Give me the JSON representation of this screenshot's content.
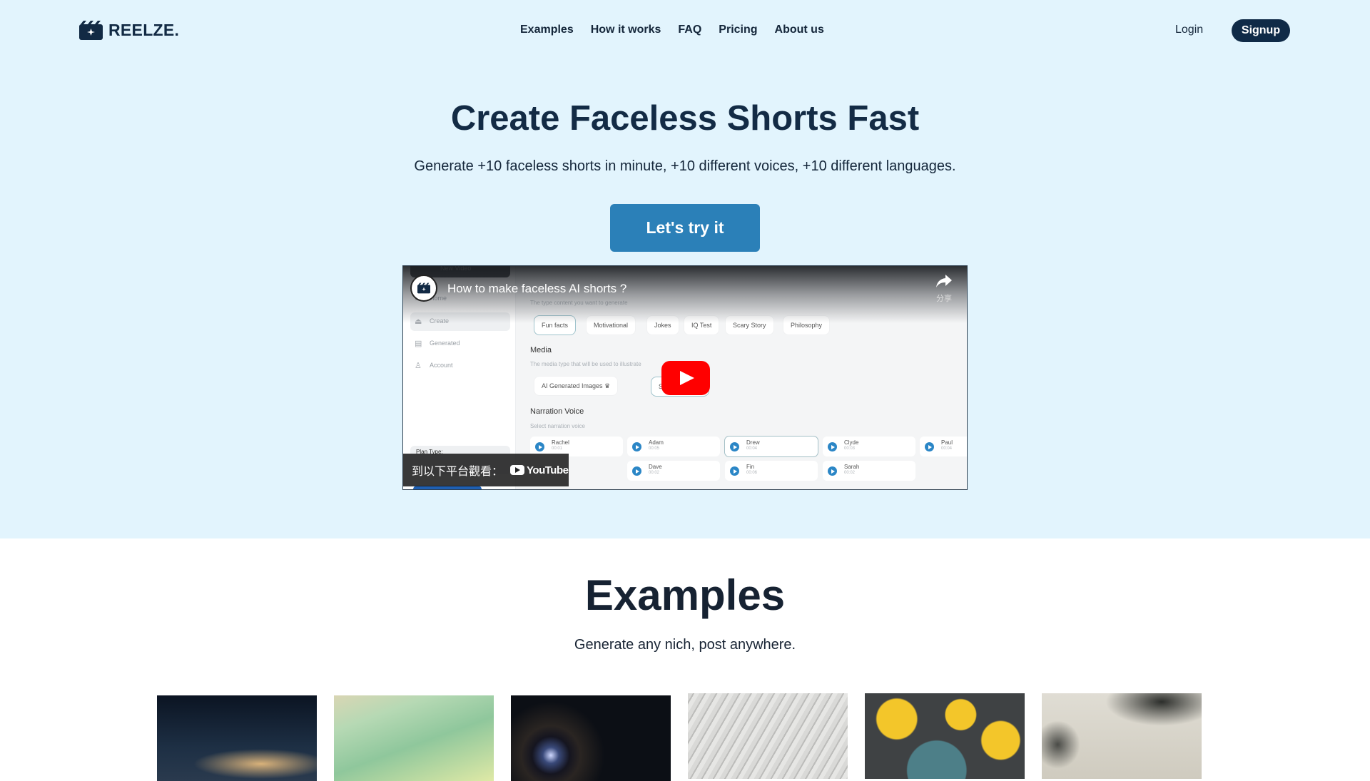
{
  "nav": {
    "brand": "REELZE.",
    "links": [
      "Examples",
      "How it works",
      "FAQ",
      "Pricing",
      "About us"
    ],
    "login": "Login",
    "signup": "Signup"
  },
  "hero": {
    "title": "Create Faceless Shorts Fast",
    "subtitle": "Generate +10 faceless shorts in minute, +10 different voices, +10 different languages.",
    "cta": "Let's try it"
  },
  "video": {
    "title": "How to make faceless AI shorts ?",
    "share_label": "分享",
    "watch_on": "到以下平台觀看：",
    "youtube_label": "YouTube",
    "app": {
      "new_video": "New Video",
      "sidebar": [
        {
          "icon": "home-icon",
          "label": "Home"
        },
        {
          "icon": "create-icon",
          "label": "Create"
        },
        {
          "icon": "generated-icon",
          "label": "Generated"
        },
        {
          "icon": "account-icon",
          "label": "Account"
        }
      ],
      "plan_type": "Plan Type:",
      "type_hint": "The type content you want to generate",
      "topics": [
        "Fun facts",
        "Motivational",
        "Jokes",
        "IQ Test",
        "Scary Story",
        "Philosophy"
      ],
      "media_label": "Media",
      "media_hint": "The media type that will be used to illustrate",
      "media_options": [
        "AI Generated Images ♛",
        "Stock Videos"
      ],
      "narration_label": "Narration Voice",
      "narration_hint": "Select narration voice",
      "voices": [
        {
          "name": "Rachel",
          "duration": "00:01"
        },
        {
          "name": "Adam",
          "duration": "00:05"
        },
        {
          "name": "Drew",
          "duration": "00:04"
        },
        {
          "name": "Clyde",
          "duration": "00:03"
        },
        {
          "name": "Paul",
          "duration": "00:04"
        },
        {
          "name": "Dave",
          "duration": "00:02"
        },
        {
          "name": "Fin",
          "duration": "00:06"
        },
        {
          "name": "Sarah",
          "duration": "00:02"
        }
      ]
    }
  },
  "examples": {
    "title": "Examples",
    "subtitle": "Generate any nich, post anywhere.",
    "thumbnails": [
      {
        "alt": "Night sky with glowing clouds"
      },
      {
        "alt": "Green room corner"
      },
      {
        "alt": "Dark eye close-up"
      },
      {
        "alt": "Marble sculpture hair"
      },
      {
        "alt": "Lemons on dark table"
      },
      {
        "alt": "Misty mountains with trees"
      }
    ]
  }
}
